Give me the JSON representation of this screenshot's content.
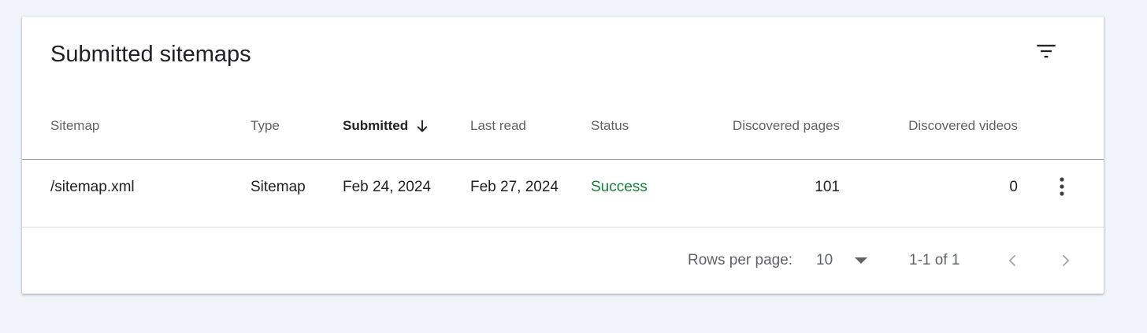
{
  "card": {
    "title": "Submitted sitemaps",
    "filter_icon": "filter-list-icon"
  },
  "table": {
    "columns": {
      "sitemap": "Sitemap",
      "type": "Type",
      "submitted": "Submitted",
      "last_read": "Last read",
      "status": "Status",
      "discovered_pages": "Discovered pages",
      "discovered_videos": "Discovered videos"
    },
    "sorted_column": "submitted",
    "sort_icon": "arrow-down-icon",
    "rows": [
      {
        "sitemap": "/sitemap.xml",
        "type": "Sitemap",
        "submitted": "Feb 24, 2024",
        "last_read": "Feb 27, 2024",
        "status": "Success",
        "discovered_pages": "101",
        "discovered_videos": "0",
        "menu_icon": "more-vert-icon"
      }
    ]
  },
  "pagination": {
    "rows_per_page_label": "Rows per page:",
    "rows_per_page_value": "10",
    "range_label": "1-1 of 1",
    "prev_icon": "chevron-left-icon",
    "next_icon": "chevron-right-icon"
  },
  "colors": {
    "background": "#f0f4fb",
    "card": "#ffffff",
    "status_success": "#188038",
    "muted_text": "#5f6368",
    "primary_text": "#202124"
  }
}
